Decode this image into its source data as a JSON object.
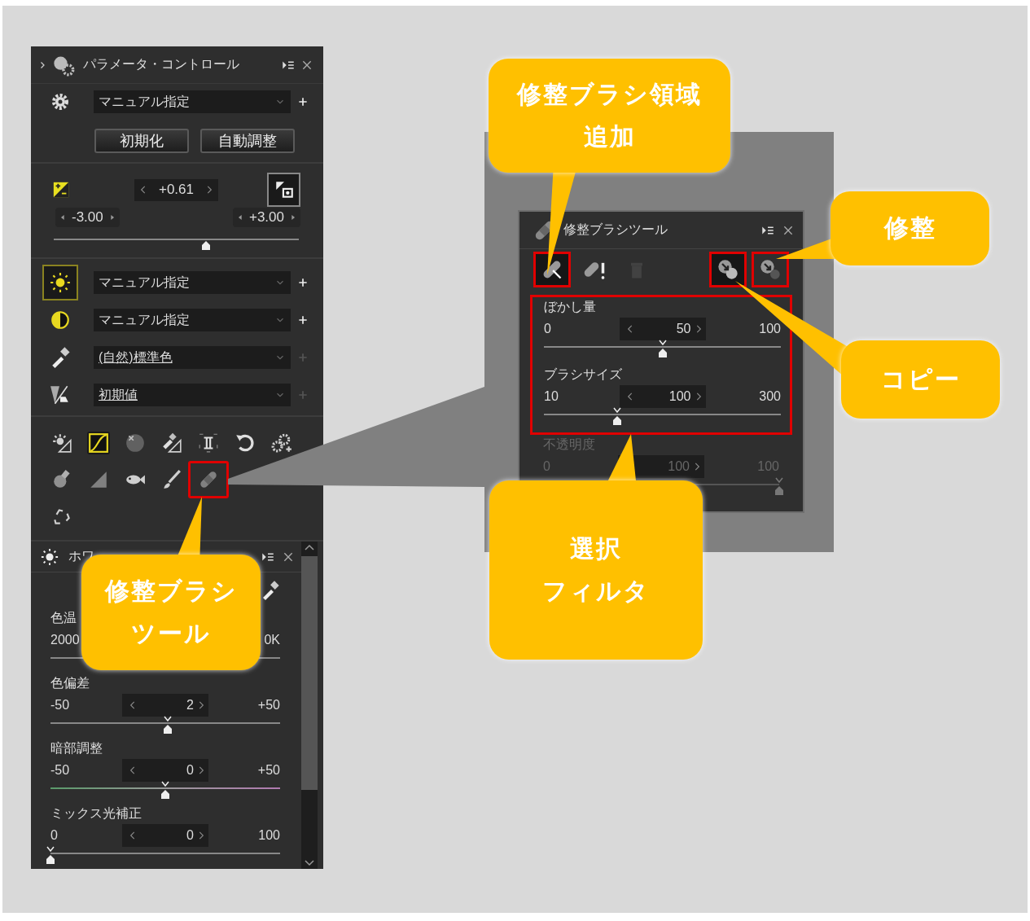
{
  "param_panel": {
    "title": "パラメータ・コントロール",
    "preset": {
      "value": "マニュアル指定"
    },
    "buttons": [
      "初期化",
      "自動調整"
    ],
    "exposure": {
      "value": "+0.61",
      "min": "-3.00",
      "max": "+3.00",
      "level": 0.62
    },
    "settings": [
      {
        "kind": "sun",
        "value": "マニュアル指定",
        "selected": true,
        "underlined": false,
        "add_enabled": true
      },
      {
        "kind": "contrast",
        "value": "マニュアル指定",
        "selected": false,
        "underlined": false,
        "add_enabled": true
      },
      {
        "kind": "dropper",
        "value": "(自然)標準色",
        "selected": false,
        "underlined": true,
        "add_enabled": false
      },
      {
        "kind": "gradient",
        "value": "初期値",
        "selected": false,
        "underlined": true,
        "add_enabled": false
      }
    ],
    "tool_rows": [
      [
        {
          "kind": "sun-tone",
          "active": false,
          "highlighted": false
        },
        {
          "kind": "curve",
          "active": true,
          "highlighted": false
        },
        {
          "kind": "ball",
          "active": false,
          "highlighted": false
        },
        {
          "kind": "dropper-tone",
          "active": false,
          "highlighted": false
        },
        {
          "kind": "bracket",
          "active": false,
          "highlighted": false
        },
        {
          "kind": "rotate",
          "active": false,
          "highlighted": false
        },
        {
          "kind": "gears",
          "active": false,
          "highlighted": false
        }
      ],
      [
        {
          "kind": "bulb",
          "active": false,
          "highlighted": false
        },
        {
          "kind": "triangle",
          "active": false,
          "highlighted": false
        },
        {
          "kind": "fish",
          "active": false,
          "highlighted": false
        },
        {
          "kind": "brush",
          "active": false,
          "highlighted": false
        },
        {
          "kind": "bandage",
          "active": false,
          "highlighted": true
        }
      ],
      [
        {
          "kind": "recycle",
          "active": false,
          "highlighted": false
        }
      ]
    ]
  },
  "wb_panel": {
    "title": "ホワ",
    "sliders": [
      {
        "label": "色温",
        "min": "2000",
        "max": "0K",
        "kind": "plain"
      },
      {
        "label": "色偏差",
        "min": "-50",
        "value": "2",
        "max": "+50",
        "level": 0.51,
        "kind": "plain"
      },
      {
        "label": "暗部調整",
        "min": "-50",
        "value": "0",
        "max": "+50",
        "level": 0.5,
        "kind": "tint"
      },
      {
        "label": "ミックス光補正",
        "min": "0",
        "value": "0",
        "max": "100",
        "level": 0,
        "kind": "plain"
      }
    ]
  },
  "brush_panel": {
    "title": "修整ブラシツール",
    "tools": [
      {
        "kind": "add-brush",
        "selected": true,
        "disabled": false,
        "highlighted": true
      },
      {
        "kind": "brush-warning",
        "selected": false,
        "disabled": false,
        "highlighted": false
      },
      {
        "kind": "trash",
        "selected": false,
        "disabled": true,
        "highlighted": false
      },
      {
        "kind": "copy",
        "selected": true,
        "disabled": false,
        "highlighted": true
      },
      {
        "kind": "retouch",
        "selected": false,
        "disabled": false,
        "highlighted": true
      }
    ],
    "sliders": [
      {
        "label": "ぼかし量",
        "min": "0",
        "value": "50",
        "max": "100",
        "level": 0.5,
        "disabled": false,
        "highlighted": true,
        "kind": "plain"
      },
      {
        "label": "ブラシサイズ",
        "min": "10",
        "value": "100",
        "max": "300",
        "level": 0.31,
        "disabled": false,
        "highlighted": true,
        "kind": "plain"
      },
      {
        "label": "不透明度",
        "min": "0",
        "value": "100",
        "max": "100",
        "level": 1,
        "disabled": true,
        "highlighted": false,
        "kind": "plain"
      }
    ]
  },
  "callouts": [
    {
      "lines": [
        "修整ブラシ領域",
        "追加"
      ]
    },
    {
      "lines": [
        "修整"
      ]
    },
    {
      "lines": [
        "コピー"
      ]
    },
    {
      "lines": [
        "選択",
        "フィルタ"
      ]
    },
    {
      "lines": [
        "修整ブラシ",
        "ツール"
      ]
    }
  ]
}
